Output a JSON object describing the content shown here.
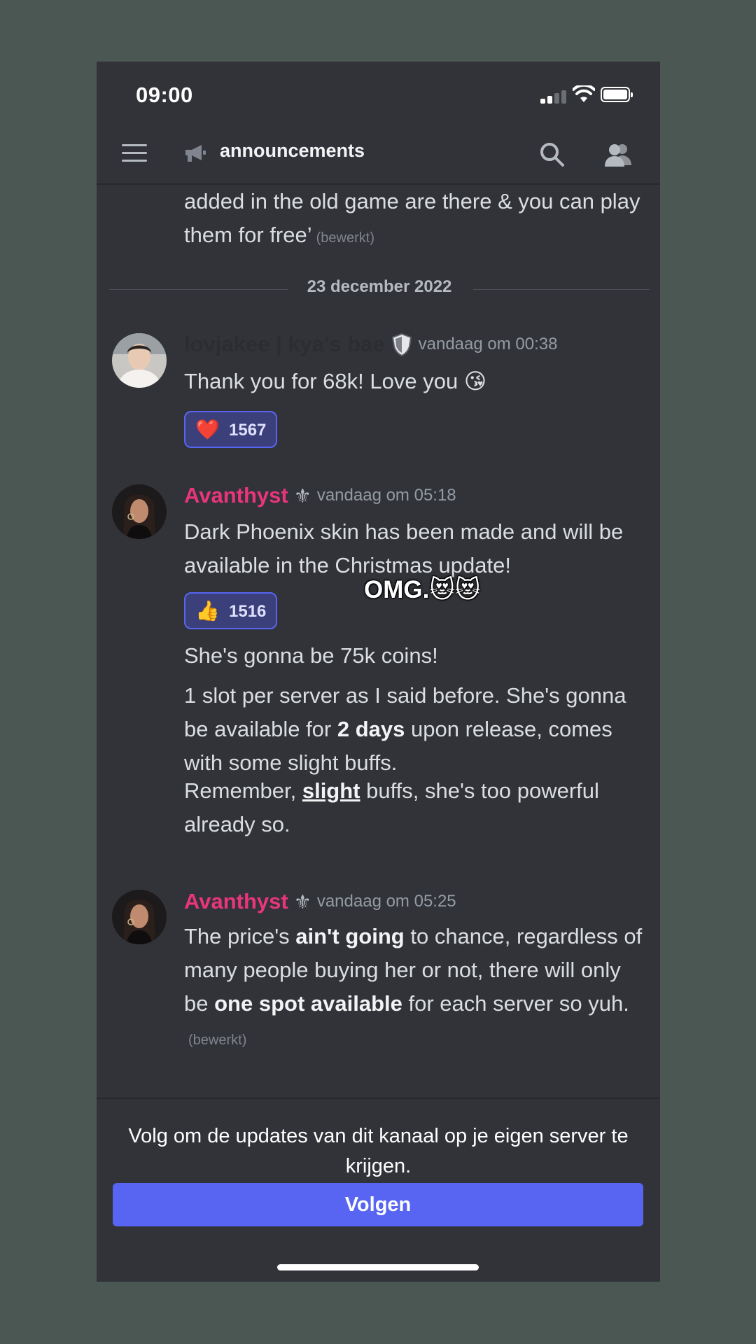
{
  "status_bar": {
    "time": "09:00"
  },
  "header": {
    "channel_name": "announcements"
  },
  "messages": {
    "partial": {
      "text": "added in the old game are there & you can play them for free’",
      "edited": "(bewerkt)"
    },
    "date_divider": "23 december 2022",
    "msg1": {
      "author": "lovjakee | kya's bae",
      "timestamp": "vandaag om 00:38",
      "text": "Thank you for 68k! Love you",
      "text_emoji": "😘",
      "reaction": {
        "emoji": "❤️",
        "count": "1567"
      }
    },
    "msg2": {
      "author": "Avanthyst",
      "badge": "⚜",
      "timestamp": "vandaag om 05:18",
      "text": "Dark Phoenix skin has been made and will be available in the Christmas update!",
      "reaction": {
        "emoji": "👍",
        "count": "1516"
      },
      "line2": "She's gonna be 75k coins!",
      "line3_a": "1 slot per server as I said before. She's gonna be available for ",
      "line3_bold": "2 days",
      "line3_b": " upon release, comes with some slight buffs.",
      "line4_a": "Remember, ",
      "line4_bold": "slight",
      "line4_b": " buffs, she's too powerful already so."
    },
    "msg3": {
      "author": "Avanthyst",
      "badge": "⚜",
      "timestamp": "vandaag om 05:25",
      "text_a": "The price's ",
      "text_bold1": "ain't going",
      "text_b": " to chance, regardless of many people buying her or not, there will only be ",
      "text_bold2": "one spot available",
      "text_c": " for each server so yuh.",
      "edited": "(bewerkt)"
    }
  },
  "overlay_caption": "OMG.😻😻",
  "follow": {
    "text": "Volg om de updates van dit kanaal op je eigen server te krijgen.",
    "button_label": "Volgen"
  },
  "colors": {
    "background": "#313338",
    "accent": "#5865f2",
    "author_pink": "#e9357b"
  }
}
